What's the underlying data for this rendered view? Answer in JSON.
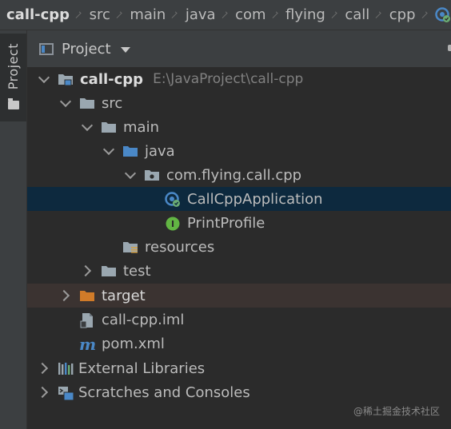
{
  "breadcrumbs": [
    "call-cpp",
    "src",
    "main",
    "java",
    "com",
    "flying",
    "call",
    "cpp"
  ],
  "breadcrumb_end_icon": "spring-boot-app-icon",
  "stripe": {
    "label": "Project",
    "icon": "folder-icon"
  },
  "panel": {
    "title": "Project"
  },
  "tree": [
    {
      "label": "call-cpp",
      "path": "E:\\JavaProject\\call-cpp",
      "icon": "module-folder-icon",
      "arrow": "down"
    },
    {
      "label": "src",
      "icon": "folder-icon",
      "arrow": "down"
    },
    {
      "label": "main",
      "icon": "folder-icon",
      "arrow": "down"
    },
    {
      "label": "java",
      "icon": "source-root-folder-icon",
      "arrow": "down"
    },
    {
      "label": "com.flying.call.cpp",
      "icon": "package-icon",
      "arrow": "down"
    },
    {
      "label": "CallCppApplication",
      "icon": "spring-boot-class-icon",
      "arrow": ""
    },
    {
      "label": "PrintProfile",
      "icon": "interface-icon",
      "arrow": ""
    },
    {
      "label": "resources",
      "icon": "resources-folder-icon",
      "arrow": ""
    },
    {
      "label": "test",
      "icon": "folder-icon",
      "arrow": "right"
    },
    {
      "label": "target",
      "icon": "excluded-folder-icon",
      "arrow": "right"
    },
    {
      "label": "call-cpp.iml",
      "icon": "iml-file-icon",
      "arrow": ""
    },
    {
      "label": "pom.xml",
      "icon": "maven-icon",
      "arrow": ""
    },
    {
      "label": "External Libraries",
      "icon": "libraries-icon",
      "arrow": "right"
    },
    {
      "label": "Scratches and Consoles",
      "icon": "scratches-icon",
      "arrow": "right"
    }
  ],
  "watermark": "@稀土掘金技术社区",
  "colors": {
    "background": "#2b2b2b",
    "panel": "#3c3f41",
    "selection": "#0d293e",
    "excluded": "#3b3331",
    "folder": "#9aa7b0",
    "source_folder": "#4a88c7",
    "excluded_folder": "#d07b29",
    "spring": "#6aab73",
    "interface": "#62b543"
  }
}
